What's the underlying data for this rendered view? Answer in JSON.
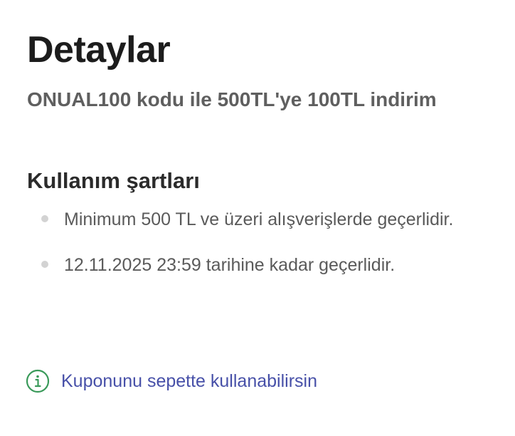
{
  "details": {
    "title": "Detaylar",
    "offer": "ONUAL100 kodu ile 500TL'ye 100TL indirim"
  },
  "terms": {
    "heading": "Kullanım şartları",
    "items": [
      "Minimum 500 TL ve üzeri alışverişlerde geçerlidir.",
      "12.11.2025 23:59 tarihine kadar geçerlidir."
    ]
  },
  "info": {
    "icon": "info-circle-icon",
    "text": "Kuponunu sepette kullanabilirsin",
    "icon_color": "#3a9a5a",
    "text_color": "#4750a8"
  }
}
